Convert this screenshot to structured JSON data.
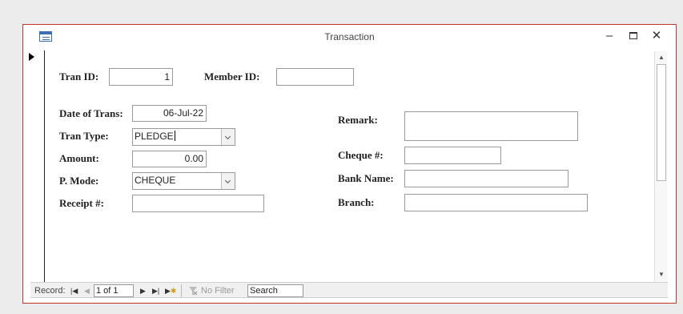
{
  "window": {
    "title": "Transaction"
  },
  "form": {
    "tran_id": {
      "label": "Tran ID:",
      "value": "1"
    },
    "member_id": {
      "label": "Member ID:",
      "value": ""
    },
    "date_of_trans": {
      "label": "Date of Trans:",
      "value": "06-Jul-22"
    },
    "tran_type": {
      "label": "Tran Type:",
      "value": "PLEDGE"
    },
    "amount": {
      "label": "Amount:",
      "value": "0.00"
    },
    "p_mode": {
      "label": "P. Mode:",
      "value": "CHEQUE"
    },
    "receipt_no": {
      "label": "Receipt #:",
      "value": ""
    },
    "remark": {
      "label": "Remark:",
      "value": ""
    },
    "cheque_no": {
      "label": "Cheque #:",
      "value": ""
    },
    "bank_name": {
      "label": "Bank Name:",
      "value": ""
    },
    "branch": {
      "label": "Branch:",
      "value": ""
    }
  },
  "navbar": {
    "record_label": "Record:",
    "position": "1 of 1",
    "filter_label": "No Filter",
    "search_label": "Search"
  },
  "icons": {
    "window": "form-icon",
    "minimize": "minimize-icon",
    "maximize": "maximize-icon",
    "close": "close-icon",
    "first": "first-record-icon",
    "prev": "previous-record-icon",
    "next": "next-record-icon",
    "last": "last-record-icon",
    "new": "new-record-icon",
    "filter": "filter-icon"
  },
  "colors": {
    "window_border": "#c0392b",
    "field_border": "#9a9a9a"
  }
}
